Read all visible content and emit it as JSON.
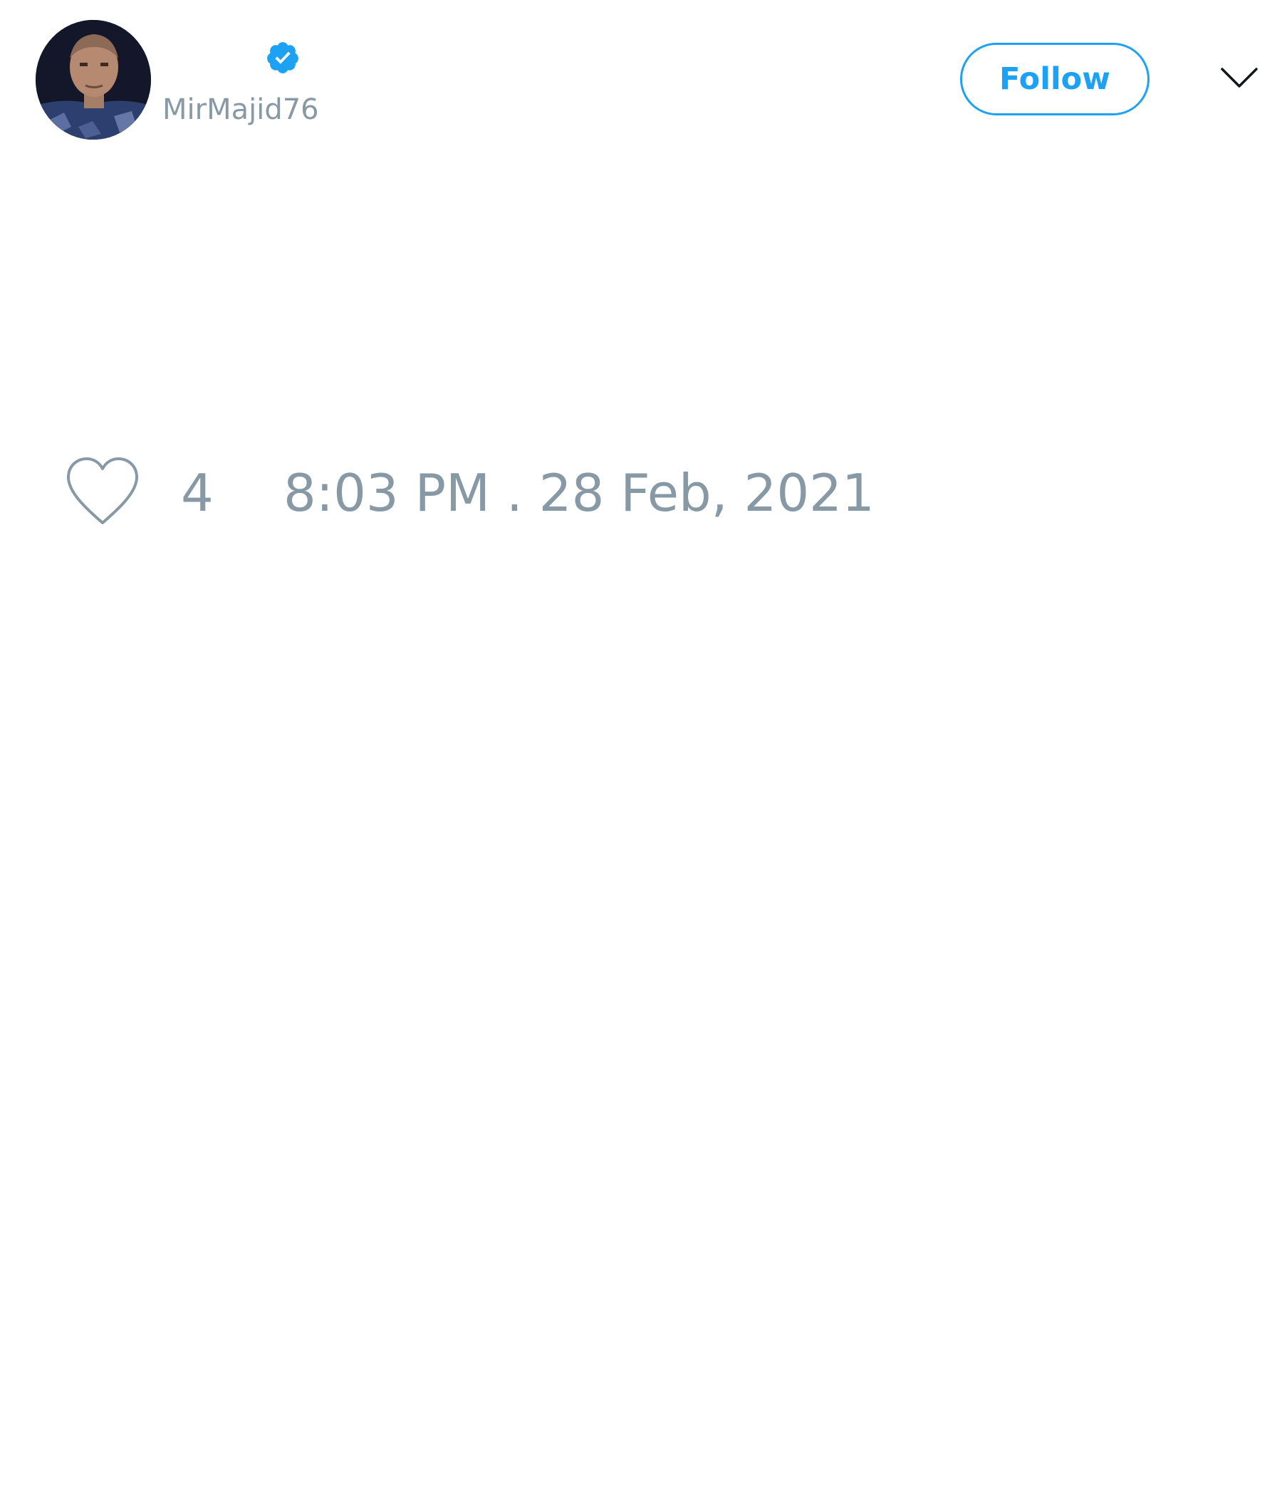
{
  "tweet": {
    "author": {
      "display_name": "",
      "handle": "MirMajid76",
      "verified": true,
      "avatar_icon": "profile-photo",
      "verified_icon": "verified-badge-icon"
    },
    "follow_label": "Follow",
    "menu_icon": "chevron-down-icon",
    "like_icon": "heart-outline-icon",
    "like_count": "4",
    "timestamp": "8:03 PM . 28 Feb, 2021"
  },
  "colors": {
    "accent": "#1da1f2",
    "muted_text": "#8899a6",
    "background": "#ffffff"
  }
}
